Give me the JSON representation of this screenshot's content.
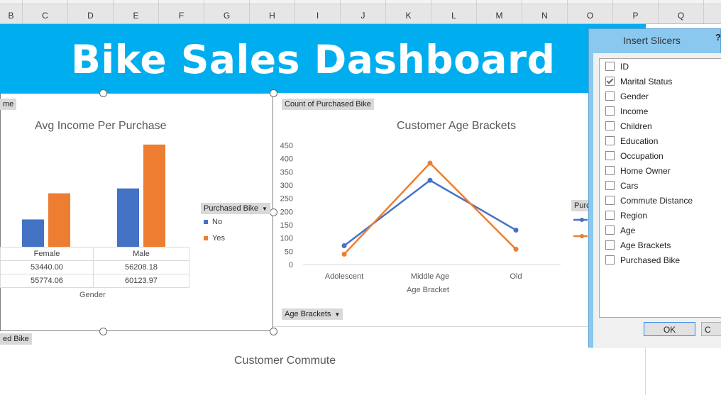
{
  "columns": [
    "B",
    "C",
    "D",
    "E",
    "F",
    "G",
    "H",
    "I",
    "J",
    "K",
    "L",
    "M",
    "N",
    "O",
    "P",
    "Q"
  ],
  "banner": {
    "title": "Bike Sales Dashboard"
  },
  "left_chart": {
    "field_top": "me",
    "field_bottom": "ed Bike",
    "title": "Avg Income Per Purchase",
    "axis_title": "Gender",
    "legend_field": "Purchased Bike",
    "legend_items": [
      "No",
      "Yes"
    ],
    "table_rows": [
      [
        "Female",
        "Male"
      ],
      [
        "53440.00",
        "56208.18"
      ],
      [
        "55774.06",
        "60123.97"
      ]
    ]
  },
  "chart_data": [
    {
      "type": "bar",
      "title": "Avg Income Per Purchase",
      "xlabel": "Gender",
      "ylabel": "",
      "categories": [
        "Female",
        "Male"
      ],
      "series": [
        {
          "name": "No",
          "values": [
            53440.0,
            56208.18
          ]
        },
        {
          "name": "Yes",
          "values": [
            55774.06,
            60123.97
          ]
        }
      ],
      "legend": "right",
      "colors": [
        "#4472c4",
        "#ed7d31"
      ]
    },
    {
      "type": "line",
      "title": "Customer Age Brackets",
      "xlabel": "Age Bracket",
      "ylabel": "",
      "categories": [
        "Adolescent",
        "Middle Age",
        "Old"
      ],
      "y_ticks": [
        "0",
        "50",
        "100",
        "150",
        "200",
        "250",
        "300",
        "350",
        "400",
        "450"
      ],
      "ylim": [
        0,
        450
      ],
      "series": [
        {
          "values": [
            71,
            318,
            130
          ]
        },
        {
          "values": [
            39,
            383,
            58
          ]
        }
      ],
      "colors": [
        "#4472c4",
        "#ed7d31"
      ]
    }
  ],
  "right_chart": {
    "field_top": "Count of Purchased Bike",
    "field_bottom": "Age Brackets",
    "legend_field": "Purc"
  },
  "commute": {
    "title": "Customer Commute"
  },
  "dialog": {
    "title": "Insert Slicers",
    "help": "?",
    "items": [
      {
        "label": "ID",
        "checked": false
      },
      {
        "label": "Marital Status",
        "checked": true
      },
      {
        "label": "Gender",
        "checked": false
      },
      {
        "label": "Income",
        "checked": false
      },
      {
        "label": "Children",
        "checked": false
      },
      {
        "label": "Education",
        "checked": false
      },
      {
        "label": "Occupation",
        "checked": false
      },
      {
        "label": "Home Owner",
        "checked": false
      },
      {
        "label": "Cars",
        "checked": false
      },
      {
        "label": "Commute Distance",
        "checked": false
      },
      {
        "label": "Region",
        "checked": false
      },
      {
        "label": "Age",
        "checked": false
      },
      {
        "label": "Age Brackets",
        "checked": false
      },
      {
        "label": "Purchased Bike",
        "checked": false
      }
    ],
    "ok_label": "OK",
    "cancel_label": "C"
  }
}
